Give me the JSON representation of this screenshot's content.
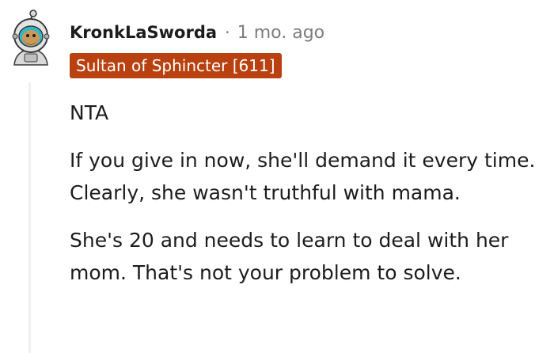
{
  "comment": {
    "username": "KronkLaSworda",
    "separator": "·",
    "timestamp": "1 mo. ago",
    "flair": "Sultan of Sphincter [611]",
    "avatar_icon": "reddit-snoo-astronaut-avatar",
    "paragraphs": [
      "NTA",
      "If you give in now, she'll demand it every time. Clearly, she wasn't truthful with mama.",
      "She's 20 and needs to learn to deal with her mom. That's not your problem to solve."
    ]
  },
  "colors": {
    "flair_background": "#b8410f",
    "flair_text": "#ffffff",
    "meta_gray": "#7c7c7c",
    "text": "#1c1c1c",
    "thread_line": "#edeff1"
  }
}
